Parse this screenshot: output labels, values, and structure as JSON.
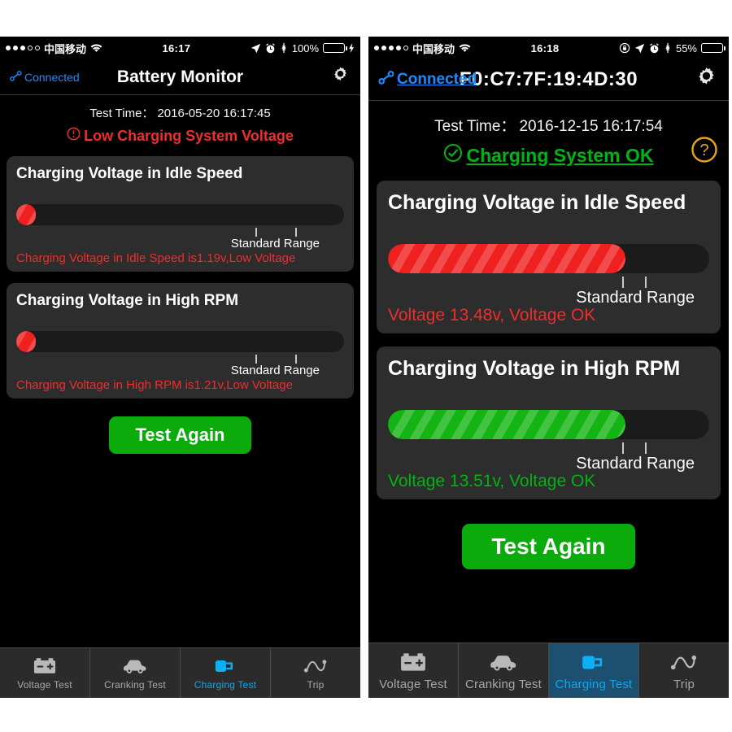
{
  "left": {
    "statusbar": {
      "signal_dots_filled": 3,
      "signal_dots_total": 5,
      "carrier": "中国移动",
      "wifi_icon": "wifi-icon",
      "time": "16:17",
      "location_icon": "location-arrow-icon",
      "alarm_icon": "alarm-clock-icon",
      "bluetooth_icon": "bluetooth-icon",
      "battery_percent": "100%",
      "battery_level": 100,
      "battery_color": "#2fd24f",
      "charging_icon": "lightning-bolt-icon"
    },
    "navbar": {
      "connection_icon": "bluetooth-link-icon",
      "connection_label": "Connected",
      "title": "Battery Monitor",
      "settings_icon": "gear-icon"
    },
    "test_time_label": "Test Time：",
    "test_time_value": "2016-05-20 16:17:45",
    "verdict_icon": "warning-circle-icon",
    "verdict_text": "Low Charging System Voltage",
    "verdict_color": "#ef2d2d",
    "cards": [
      {
        "title": "Charging Voltage in Idle Speed",
        "value_label": "1.19v",
        "value_color": "#ef2d2d",
        "fill_percent": 6,
        "fill_color": "red",
        "caret_percent": 6,
        "range_start_percent": 73,
        "range_end_percent": 85,
        "range_label": "Standard Range",
        "note": "Charging Voltage in Idle Speed is1.19v,Low Voltage",
        "note_color": "#ef2d2d"
      },
      {
        "title": "Charging Voltage in High RPM",
        "value_label": "1.21v",
        "value_color": "#ef2d2d",
        "fill_percent": 6,
        "fill_color": "red",
        "caret_percent": 6,
        "range_start_percent": 73,
        "range_end_percent": 85,
        "range_label": "Standard Range",
        "note": "Charging Voltage in High RPM is1.21v,Low Voltage",
        "note_color": "#ef2d2d"
      }
    ],
    "test_again_label": "Test Again",
    "tabs": [
      {
        "label": "Voltage Test",
        "icon": "car-battery-icon",
        "active": false
      },
      {
        "label": "Cranking Test",
        "icon": "car-icon",
        "active": false
      },
      {
        "label": "Charging Test",
        "icon": "plug-icon",
        "active": true
      },
      {
        "label": "Trip",
        "icon": "trip-curve-icon",
        "active": false
      }
    ]
  },
  "right": {
    "statusbar": {
      "signal_dots_filled": 4,
      "signal_dots_total": 5,
      "carrier": "中国移动",
      "wifi_icon": "wifi-icon",
      "time": "16:18",
      "rotation_lock_icon": "rotation-lock-icon",
      "location_icon": "location-arrow-icon",
      "alarm_icon": "alarm-clock-icon",
      "bluetooth_icon": "bluetooth-icon",
      "battery_percent": "55%",
      "battery_level": 55,
      "battery_color": "#ffffff",
      "charging_icon": ""
    },
    "navbar": {
      "connection_icon": "bluetooth-link-icon",
      "connection_label": "Connected",
      "title": "F0:C7:7F:19:4D:30",
      "settings_icon": "gear-icon"
    },
    "test_time_label": "Test Time：",
    "test_time_value": "2016-12-15 16:17:54",
    "verdict_icon": "check-circle-icon",
    "verdict_text": "Charging System OK",
    "verdict_color": "#00b512",
    "help_icon": "help-question-icon",
    "help_color": "#e8a317",
    "cards": [
      {
        "title": "Charging Voltage in Idle Speed",
        "value_label": "13.48v",
        "value_color": "#ef2d2d",
        "fill_percent": 74,
        "fill_color": "red",
        "caret_percent": 74,
        "range_start_percent": 73,
        "range_end_percent": 80,
        "range_label": "Standard Range",
        "note": "Voltage 13.48v, Voltage OK",
        "note_color": "#ef2d2d"
      },
      {
        "title": "Charging Voltage in High RPM",
        "value_label": "13.51v",
        "value_color": "#00b512",
        "fill_percent": 74,
        "fill_color": "green",
        "caret_percent": 74,
        "range_start_percent": 73,
        "range_end_percent": 80,
        "range_label": "Standard Range",
        "note": "Voltage 13.51v, Voltage OK",
        "note_color": "#00b512"
      }
    ],
    "test_again_label": "Test Again",
    "tabs": [
      {
        "label": "Voltage Test",
        "icon": "car-battery-icon",
        "active": false
      },
      {
        "label": "Cranking Test",
        "icon": "car-icon",
        "active": false
      },
      {
        "label": "Charging Test",
        "icon": "plug-icon",
        "active": true
      },
      {
        "label": "Trip",
        "icon": "trip-curve-icon",
        "active": false
      }
    ]
  }
}
